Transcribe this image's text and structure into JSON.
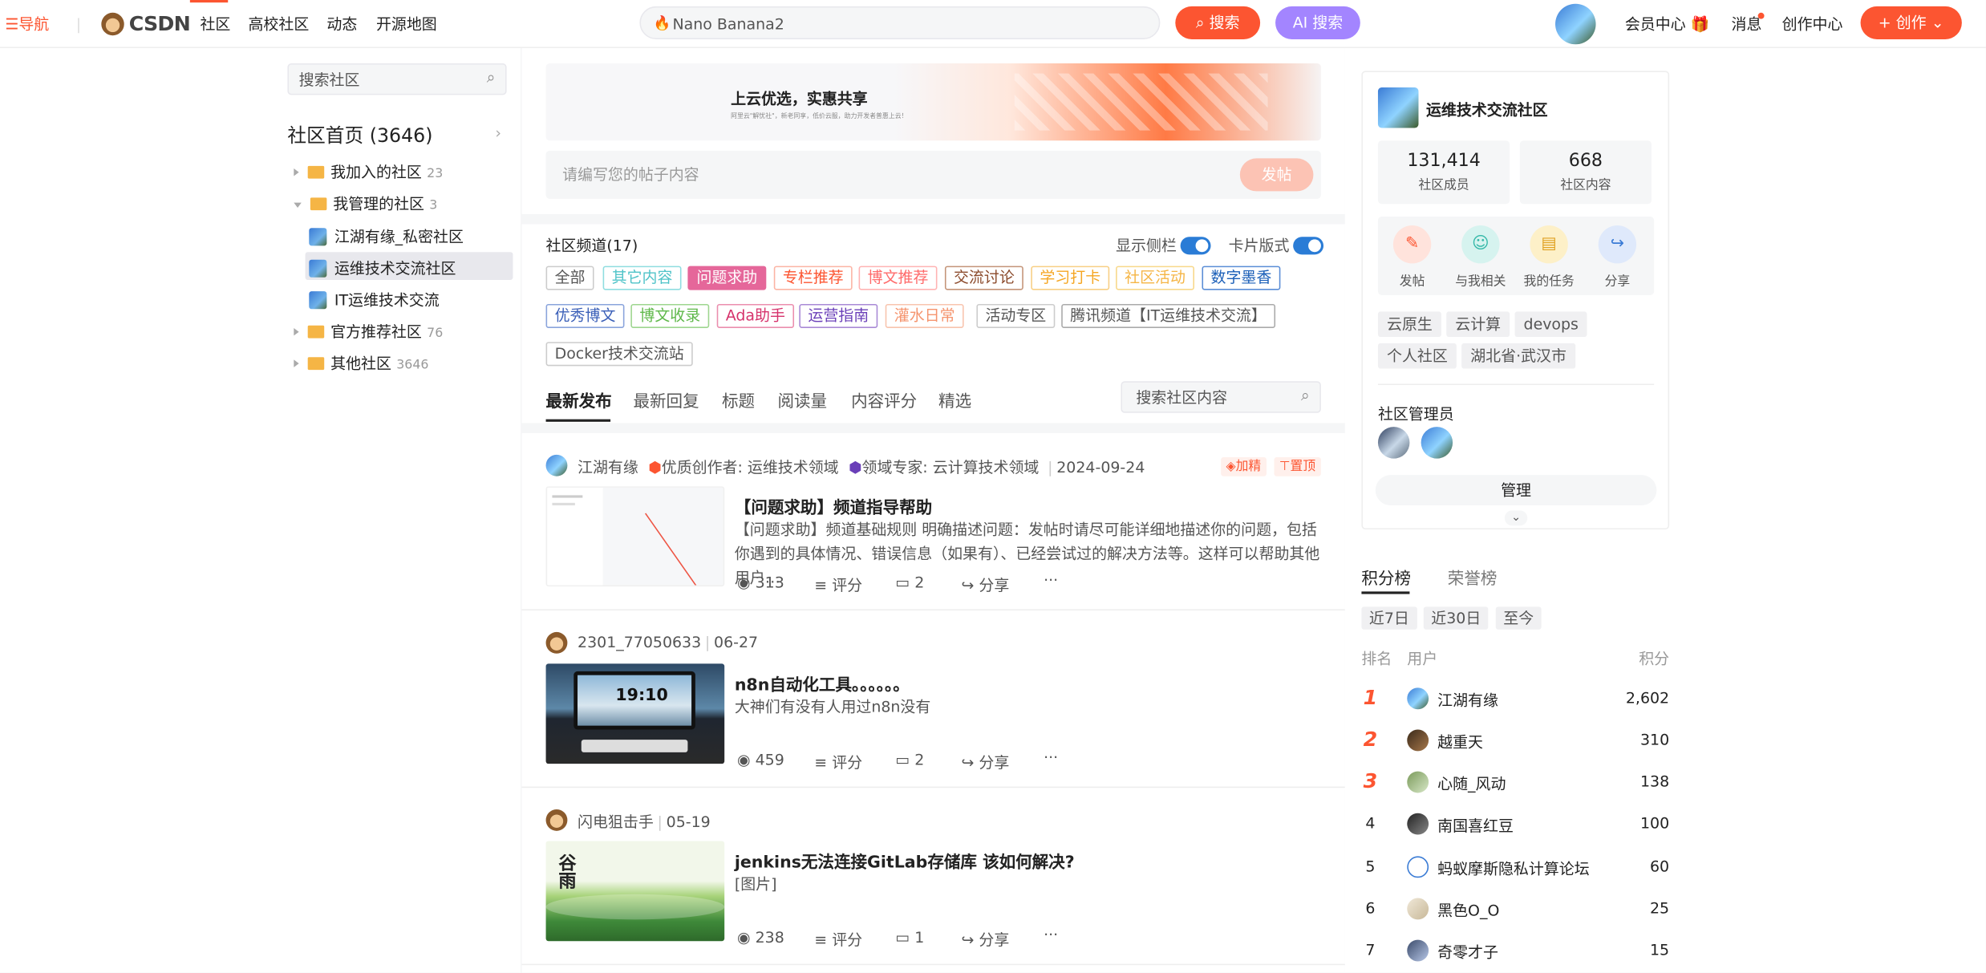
{
  "nav": {
    "menu": "导航",
    "logo": "CSDN",
    "links": [
      "社区",
      "高校社区",
      "动态",
      "开源地图"
    ],
    "search_value": "Nano Banana2",
    "search_btn": "搜索",
    "ai_btn": "AI 搜索",
    "vip": "会员中心",
    "msg": "消息",
    "creator": "创作中心",
    "create": "创作"
  },
  "left": {
    "search_placeholder": "搜索社区",
    "home": "社区首页 (3646)",
    "joined": {
      "label": "我加入的社区",
      "count": "23"
    },
    "managed": {
      "label": "我管理的社区",
      "count": "3"
    },
    "managed_items": [
      "江湖有缘_私密社区",
      "运维技术交流社区",
      "IT运维技术交流"
    ],
    "official": {
      "label": "官方推荐社区",
      "count": "76"
    },
    "other": {
      "label": "其他社区",
      "count": "3646"
    }
  },
  "banner": {
    "title": "上云优选，实惠共享",
    "sub": "阿里云\"解忧社\"，新老同享，低价云服，助力开发者普惠上云！"
  },
  "composer": {
    "placeholder": "请编写您的帖子内容",
    "button": "发帖"
  },
  "channels": {
    "title": "社区频道(17)",
    "sidebar_toggle": "显示侧栏",
    "card_toggle": "卡片版式",
    "tags": [
      "全部",
      "其它内容",
      "问题求助",
      "专栏推荐",
      "博文推荐",
      "交流讨论",
      "学习打卡",
      "社区活动",
      "数字墨香",
      "优秀博文",
      "博文收录",
      "Ada助手",
      "运营指南",
      "灌水日常",
      "活动专区",
      "腾讯频道【IT运维技术交流】",
      "Docker技术交流站"
    ]
  },
  "feed_tabs": [
    "最新发布",
    "最新回复",
    "标题",
    "阅读量",
    "内容评分",
    "精选"
  ],
  "feed_search_placeholder": "搜索社区内容",
  "posts": [
    {
      "author": "江湖有缘",
      "badge1": "优质创作者: 运维技术领域",
      "badge2": "领域专家: 云计算技术领域",
      "date": "2024-09-24",
      "tag_hot": "加精",
      "tag_top": "置顶",
      "title": "【问题求助】频道指导帮助",
      "desc": "【问题求助】频道基础规则 明确描述问题：发帖时请尽可能详细地描述你的问题，包括你遇到的具体情况、错误信息（如果有）、已经尝试过的解决方法等。这样可以帮助其他用户…",
      "views": "313",
      "rate": "评分",
      "comments": "2",
      "share": "分享",
      "more": "···"
    },
    {
      "author": "2301_77050633",
      "date": "06-27",
      "title": "n8n自动化工具。。。。。。",
      "desc": "大神们有没有人用过n8n没有",
      "thumb_text": "19:10",
      "views": "459",
      "rate": "评分",
      "comments": "2",
      "share": "分享",
      "more": "···"
    },
    {
      "author": "闪电狙击手",
      "date": "05-19",
      "title": "jenkins无法连接GitLab存储库 该如何解决?",
      "desc": "[图片]",
      "thumb_text": "谷雨",
      "views": "238",
      "rate": "评分",
      "comments": "1",
      "share": "分享",
      "more": "···"
    }
  ],
  "community": {
    "name": "运维技术交流社区",
    "members": "131,414",
    "members_label": "社区成员",
    "contents": "668",
    "contents_label": "社区内容",
    "actions": [
      "发帖",
      "与我相关",
      "我的任务",
      "分享"
    ],
    "tags": [
      "云原生",
      "云计算",
      "devops",
      "个人社区",
      "湖北省·武汉市"
    ],
    "admin_label": "社区管理员",
    "manage": "管理"
  },
  "leaderboard": {
    "tabs": [
      "积分榜",
      "荣誉榜"
    ],
    "periods": [
      "近7日",
      "近30日",
      "至今"
    ],
    "headers": {
      "rank": "排名",
      "user": "用户",
      "score": "积分"
    },
    "rows": [
      {
        "rank": "1",
        "user": "江湖有缘",
        "score": "2,602"
      },
      {
        "rank": "2",
        "user": "越重天",
        "score": "310"
      },
      {
        "rank": "3",
        "user": "心随_风动",
        "score": "138"
      },
      {
        "rank": "4",
        "user": "南国喜红豆",
        "score": "100"
      },
      {
        "rank": "5",
        "user": "蚂蚁摩斯隐私计算论坛",
        "score": "60"
      },
      {
        "rank": "6",
        "user": "黑色O_O",
        "score": "25"
      },
      {
        "rank": "7",
        "user": "奇零才子",
        "score": "15"
      }
    ]
  },
  "colors": {
    "brand": "#fc5531",
    "ai": "#a385ff",
    "toggle": "#2a7cd6"
  }
}
